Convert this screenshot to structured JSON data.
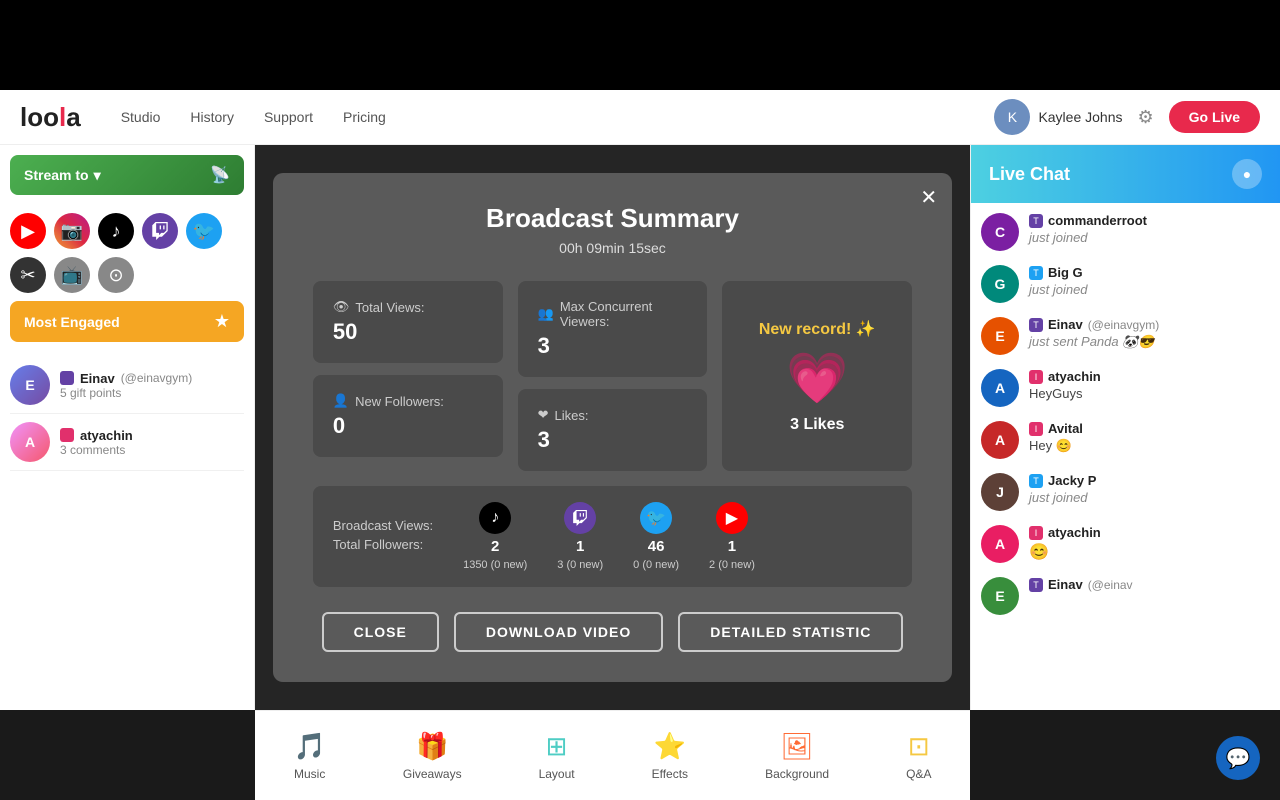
{
  "app": {
    "name": "loola",
    "logo_color": "#e8294c"
  },
  "nav": {
    "items": [
      "Studio",
      "History",
      "Support",
      "Pricing"
    ]
  },
  "header": {
    "user_name": "Kaylee Johns",
    "go_live_label": "Go Live"
  },
  "stream_to": {
    "label": "Stream to",
    "chevron": "▾"
  },
  "most_engaged": {
    "label": "Most Engaged",
    "users": [
      {
        "name": "Einav",
        "handle": "(@einavgym)",
        "meta": "5 gift points",
        "platform": "tiktok",
        "initials": "E"
      },
      {
        "name": "atyachin",
        "handle": "",
        "meta": "3 comments",
        "platform": "instagram",
        "initials": "A"
      }
    ]
  },
  "modal": {
    "title": "Broadcast Summary",
    "subtitle": "00h 09min 15sec",
    "close_x": "✕",
    "stats": {
      "total_views_label": "Total Views:",
      "total_views_value": "50",
      "max_concurrent_label": "Max Concurrent Viewers:",
      "max_concurrent_value": "3",
      "new_followers_label": "New Followers:",
      "new_followers_value": "0",
      "likes_label": "Likes:",
      "likes_value": "3",
      "new_record": "New record! ✨",
      "likes_count_label": "3 Likes"
    },
    "broadcast": {
      "views_label": "Broadcast Views:",
      "followers_label": "Total Followers:",
      "platforms": [
        {
          "name": "tiktok",
          "views": "2",
          "followers": "1350 (0 new)"
        },
        {
          "name": "twitch",
          "views": "1",
          "followers": "3 (0 new)"
        },
        {
          "name": "twitter",
          "views": "46",
          "followers": "0 (0 new)"
        },
        {
          "name": "youtube",
          "views": "1",
          "followers": "2 (0 new)"
        }
      ]
    },
    "buttons": {
      "close": "CLOSE",
      "download": "DOWNLOAD VIDEO",
      "statistic": "DETAILED STATISTIC"
    }
  },
  "toolbar": {
    "items": [
      {
        "label": "Music",
        "icon": "🎵",
        "color": "#e91e63"
      },
      {
        "label": "Giveaways",
        "icon": "🎁",
        "color": "#e91e63"
      },
      {
        "label": "Layout",
        "icon": "⊞",
        "color": "#4ecdc4"
      },
      {
        "label": "Effects",
        "icon": "⭐",
        "color": "#a8e063"
      },
      {
        "label": "Background",
        "icon": "🖼",
        "color": "#ff6b35"
      },
      {
        "label": "Q&A",
        "icon": "⊡",
        "color": "#f5c842"
      }
    ]
  },
  "live_chat": {
    "title": "Live Chat",
    "messages": [
      {
        "username": "commanderroot",
        "handle": "",
        "platform": "twitch",
        "text": "just joined",
        "type": "action",
        "avatar_color": "purple",
        "initials": "C"
      },
      {
        "username": "Big G",
        "handle": "",
        "platform": "twitter",
        "text": "just joined",
        "type": "action",
        "avatar_color": "teal",
        "initials": "G"
      },
      {
        "username": "Einav",
        "handle": "(@einavgym)",
        "platform": "twitch",
        "text": "just sent Panda 🐼😎",
        "type": "action",
        "avatar_color": "orange",
        "initials": "E"
      },
      {
        "username": "atyachin",
        "handle": "",
        "platform": "instagram",
        "text": "HeyGuys",
        "type": "message",
        "avatar_color": "blue",
        "initials": "A"
      },
      {
        "username": "Avital",
        "handle": "",
        "platform": "instagram",
        "text": "Hey 😊",
        "type": "message",
        "avatar_color": "red",
        "initials": "A"
      },
      {
        "username": "Jacky P",
        "handle": "",
        "platform": "twitter",
        "text": "just joined",
        "type": "action",
        "avatar_color": "brown",
        "initials": "J"
      },
      {
        "username": "atyachin",
        "handle": "",
        "platform": "instagram",
        "text": "😊",
        "type": "message",
        "avatar_color": "pink",
        "initials": "A"
      },
      {
        "username": "Einav",
        "handle": "(@einav",
        "platform": "twitch",
        "text": "",
        "type": "action",
        "avatar_color": "green",
        "initials": "E"
      }
    ]
  }
}
